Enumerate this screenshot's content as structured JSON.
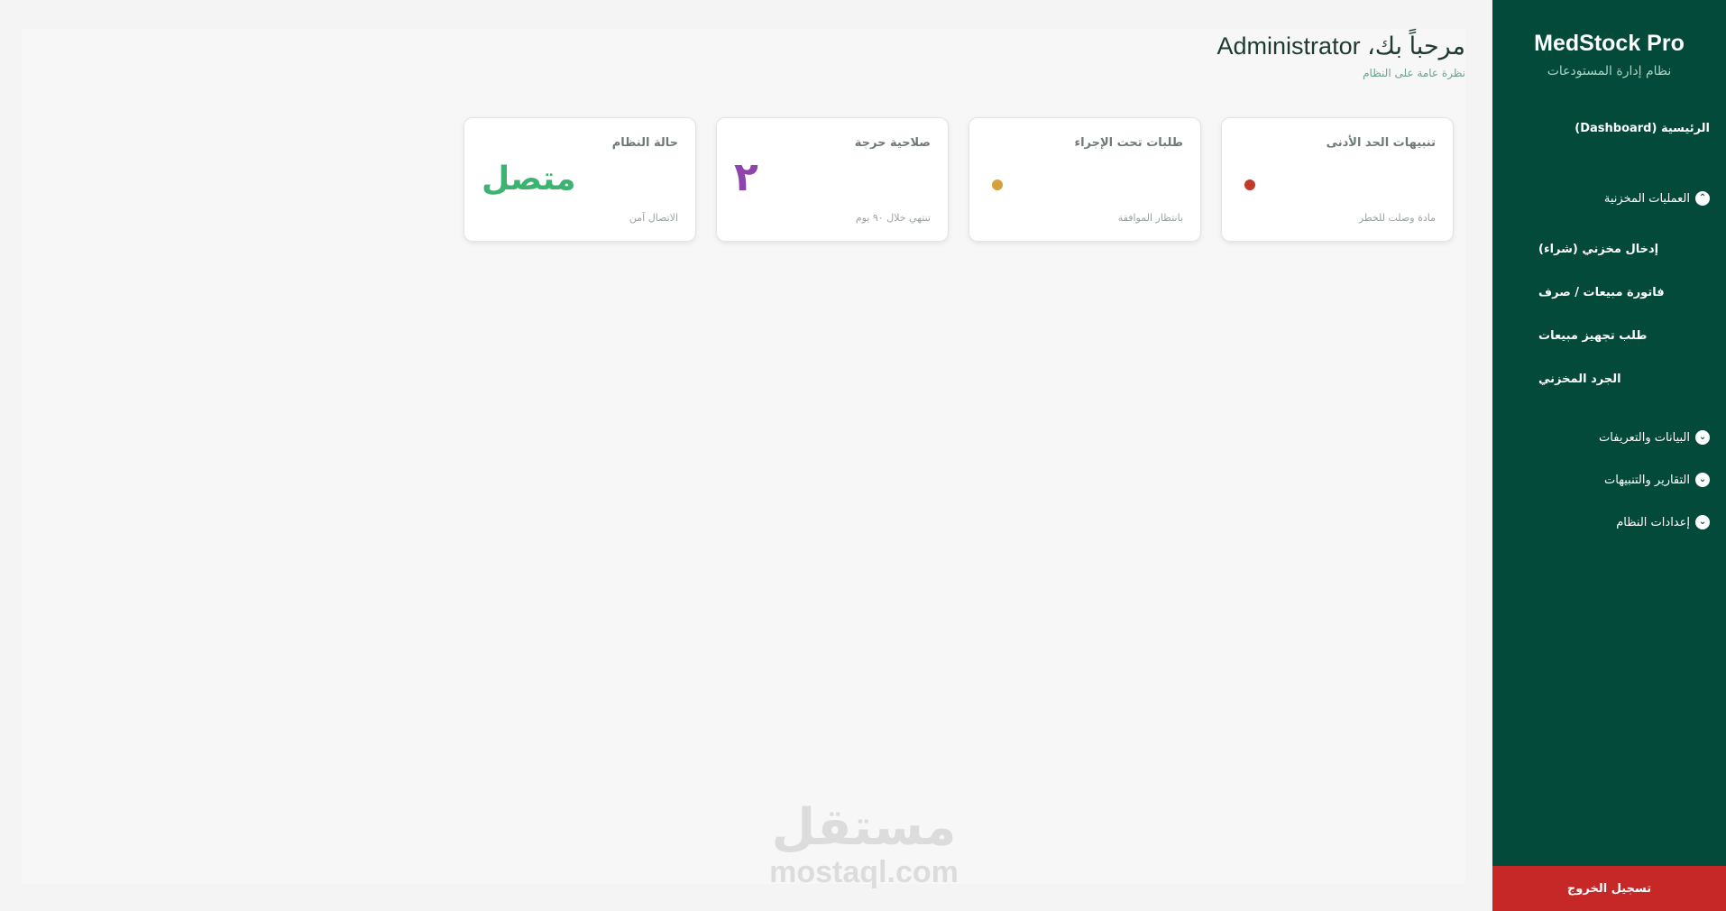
{
  "sidebar": {
    "brand_title": "MedStock Pro",
    "brand_subtitle": "نظام إدارة المستودعات",
    "dashboard_label": "الرئيسية (Dashboard)",
    "sections": [
      {
        "label": "العمليات المخزنية",
        "expanded": true,
        "icon": "chevron-up-icon",
        "items": [
          "إدخال مخزني (شراء)",
          "فاتورة مبيعات / صرف",
          "طلب تجهيز مبيعات",
          "الجرد المخزني"
        ]
      },
      {
        "label": "البيانات والتعريفات",
        "expanded": false,
        "icon": "chevron-down-icon"
      },
      {
        "label": "التقارير والتنبيهات",
        "expanded": false,
        "icon": "chevron-down-icon"
      },
      {
        "label": "إعدادات النظام",
        "expanded": false,
        "icon": "chevron-down-icon"
      }
    ],
    "logout_label": "تسجيل الخروج"
  },
  "header": {
    "welcome": "مرحباً بك، Administrator",
    "subtitle": "نظرة عامة على النظام"
  },
  "cards": [
    {
      "title": "تنبيهات الحد الأدنى",
      "note": "مادة وصلت للخطر",
      "indicator_color": "#c0392b"
    },
    {
      "title": "طلبات تحت الإجراء",
      "note": "بانتظار الموافقة",
      "indicator_color": "#d4a13a"
    },
    {
      "title": "صلاحية حرجة",
      "value": "٢",
      "note": "تنتهي خلال ٩٠ يوم",
      "value_color": "#8e44ad"
    },
    {
      "title": "حالة النظام",
      "value": "متصل",
      "note": "الاتصال آمن",
      "value_color": "#3cb371"
    }
  ],
  "watermark": {
    "arabic": "مستقل",
    "latin": "mostaql.com"
  },
  "colors": {
    "sidebar_bg": "#034a3b",
    "logout_bg": "#c62828",
    "page_bg": "#f3f4f3"
  }
}
